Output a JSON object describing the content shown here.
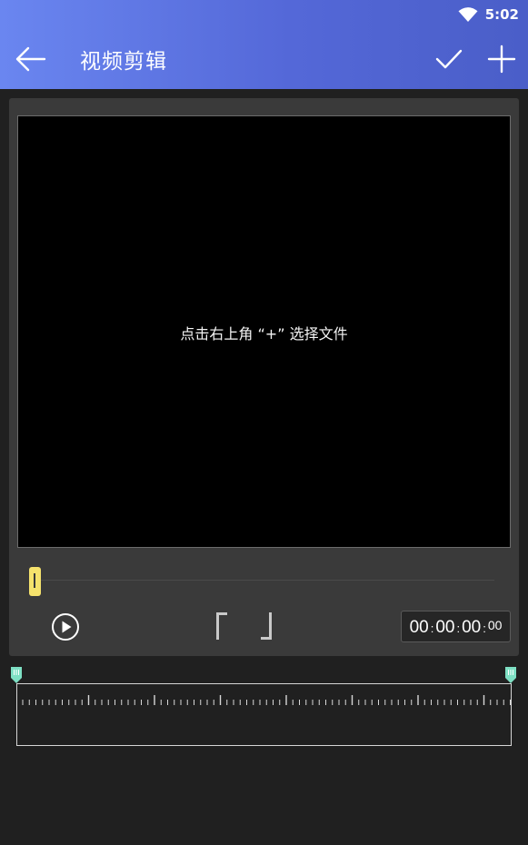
{
  "status_bar": {
    "time": "5:02",
    "wifi_icon": "wifi-icon"
  },
  "toolbar": {
    "title": "视频剪辑",
    "back_icon": "arrow-left-icon",
    "confirm_icon": "check-icon",
    "add_icon": "plus-icon"
  },
  "preview": {
    "hint": "点击右上角 “+” 选择文件"
  },
  "player": {
    "play_icon": "play-circle-icon",
    "seek_progress": 0,
    "mark_in_icon": "bracket-left-icon",
    "mark_out_icon": "bracket-right-icon",
    "timecode": {
      "hours": "00",
      "minutes": "00",
      "seconds": "00",
      "frames": "00"
    }
  },
  "timeline": {
    "trim_start": 0,
    "trim_end": 1
  },
  "colors": {
    "appbar_gradient": [
      "#6a86f0",
      "#4a5ec8"
    ],
    "background": "#202020",
    "card": "#3a3a3a",
    "seek_thumb": "#f5e26c",
    "trim_handle": "#7ee0c4"
  }
}
